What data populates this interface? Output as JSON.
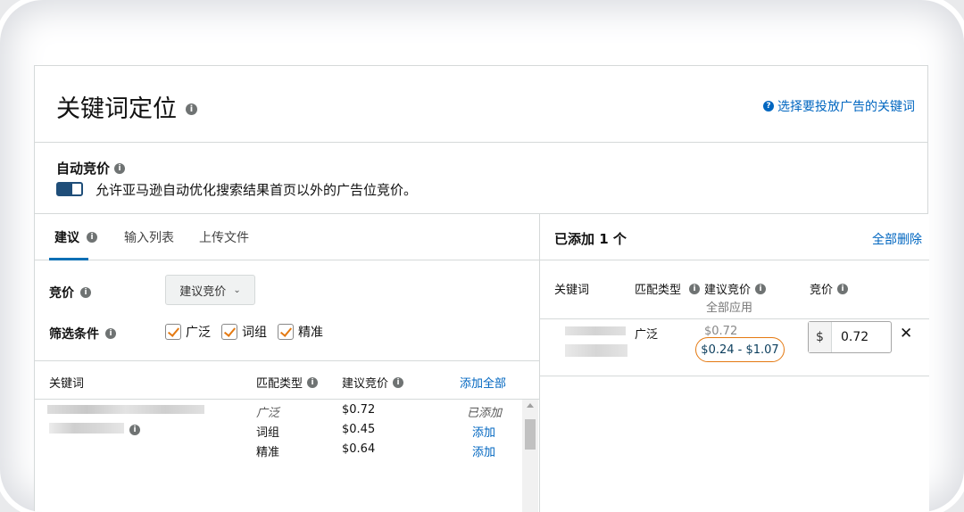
{
  "header": {
    "title": "关键词定位",
    "help_link": "选择要投放广告的关键词",
    "help_icon": "?"
  },
  "auto_bid": {
    "title": "自动竞价",
    "description": "允许亚马逊自动优化搜索结果首页以外的广告位竞价。",
    "toggle_state": "on"
  },
  "tabs": [
    {
      "label": "建议"
    },
    {
      "label": "输入列表"
    },
    {
      "label": "上传文件"
    }
  ],
  "bid": {
    "label": "竞价",
    "select_value": "建议竞价"
  },
  "filter": {
    "label": "筛选条件",
    "options": [
      {
        "label": "广泛",
        "checked": true
      },
      {
        "label": "词组",
        "checked": true
      },
      {
        "label": "精准",
        "checked": true
      }
    ]
  },
  "left_table": {
    "headers": {
      "keyword": "关键词",
      "match_type": "匹配类型",
      "suggested_bid": "建议竞价",
      "add_all": "添加全部"
    },
    "rows": [
      {
        "match": "广泛",
        "bid": "$0.72",
        "action": "已添加"
      },
      {
        "match": "词组",
        "bid": "$0.45",
        "action": "添加"
      },
      {
        "match": "精准",
        "bid": "$0.64",
        "action": "添加"
      }
    ]
  },
  "right_panel": {
    "title": "已添加 1 个",
    "delete_all": "全部删除",
    "headers": {
      "keyword": "关键词",
      "match_type": "匹配类型",
      "suggested_bid": "建议竞价",
      "bid": "竞价",
      "apply_all": "全部应用"
    },
    "row": {
      "match": "广泛",
      "suggested": "$0.72",
      "range": "$0.24 - $1.07",
      "currency": "$",
      "bid_value": "0.72",
      "remove": "✕"
    }
  },
  "colors": {
    "link": "#0066c0",
    "accent": "#e47911",
    "toggle": "#1f4e79"
  }
}
